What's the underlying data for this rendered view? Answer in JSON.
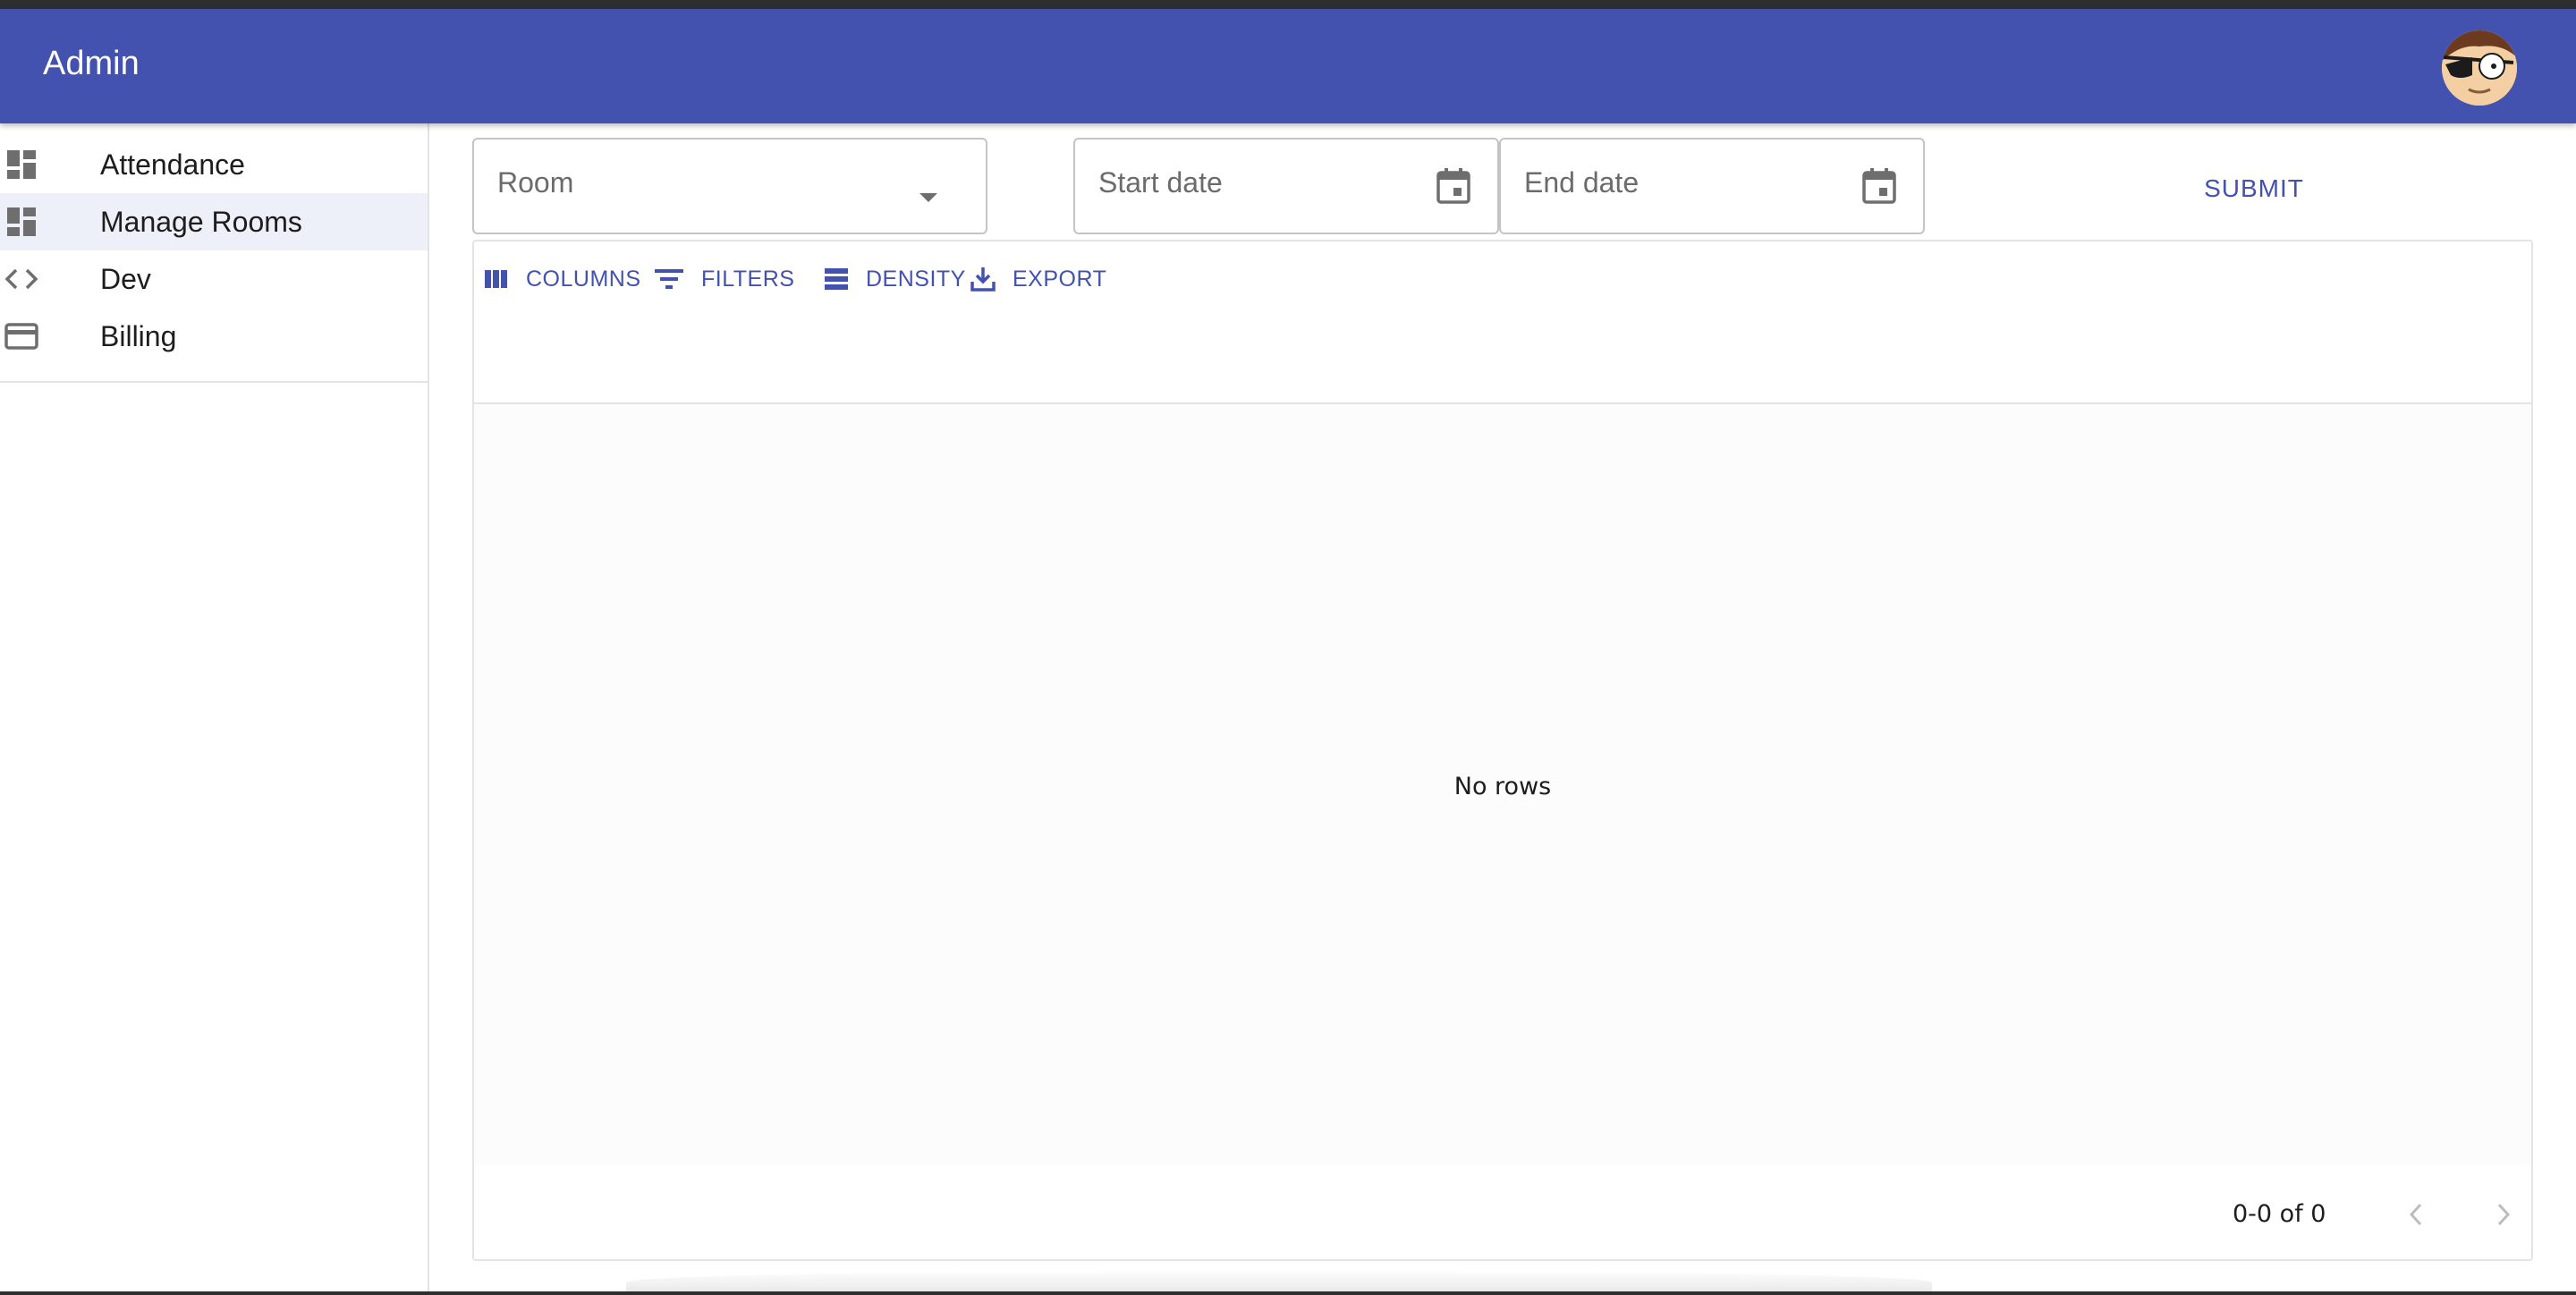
{
  "appbar": {
    "title": "Admin",
    "avatar_icon": "avatar-eyepatch"
  },
  "sidebar": {
    "items": [
      {
        "label": "Attendance",
        "icon": "dashboard-icon",
        "selected": false
      },
      {
        "label": "Manage Rooms",
        "icon": "dashboard-icon",
        "selected": true
      },
      {
        "label": "Dev",
        "icon": "code-icon",
        "selected": false
      },
      {
        "label": "Billing",
        "icon": "credit-card-icon",
        "selected": false
      }
    ]
  },
  "filters": {
    "room_label": "Room",
    "start_date_label": "Start date",
    "end_date_label": "End date",
    "submit_label": "SUBMIT"
  },
  "grid": {
    "toolbar": {
      "columns_label": "COLUMNS",
      "filters_label": "FILTERS",
      "density_label": "DENSITY",
      "export_label": "EXPORT"
    },
    "empty_text": "No rows",
    "pagination": {
      "range_text": "0-0 of 0"
    }
  },
  "colors": {
    "primary": "#4351af",
    "selected_bg": "#eef0f9",
    "icon_gray": "#6e6e6e"
  }
}
